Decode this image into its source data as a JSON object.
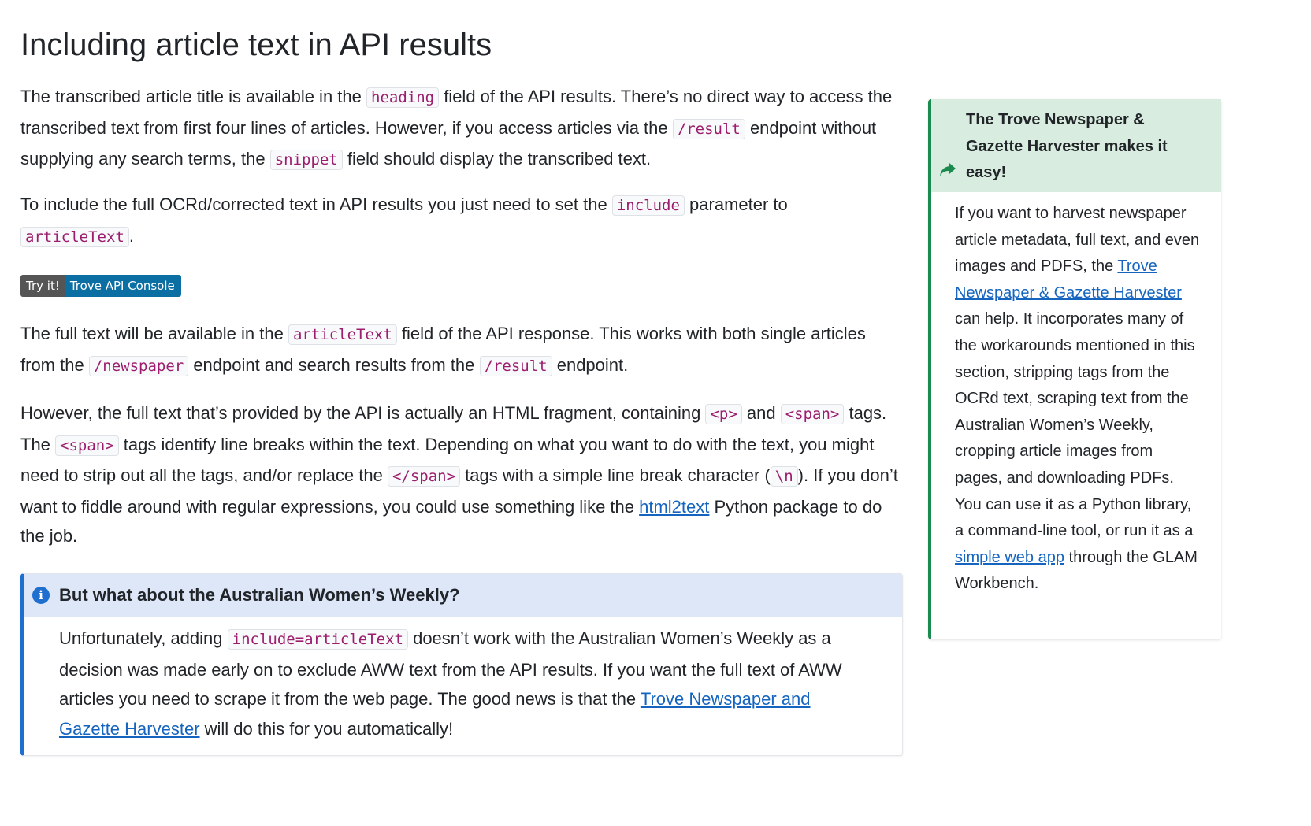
{
  "heading": "Including article text in API results",
  "para1": {
    "t1": "The transcribed article title is available in the ",
    "c1": "heading",
    "t2": " field of the API results. There’s no direct way to access the transcribed text from first four lines of articles. However, if you access articles via the ",
    "c2": "/result",
    "t3": " endpoint without supplying any search terms, the ",
    "c3": "snippet",
    "t4": " field should display the transcribed text."
  },
  "para2": {
    "t1": "To include the full OCRd/corrected text in API results you just need to set the ",
    "c1": "include",
    "t2": " parameter to ",
    "c2": "articleText",
    "t3": "."
  },
  "badge": {
    "left": "Try it!",
    "right": "Trove API Console"
  },
  "para3": {
    "t1": "The full text will be available in the ",
    "c1": "articleText",
    "t2": " field of the API response. This works with both single articles from the ",
    "c2": "/newspaper",
    "t3": " endpoint and search results from the ",
    "c3": "/result",
    "t4": " endpoint."
  },
  "para4": {
    "t1": "However, the full text that’s provided by the API is actually an HTML fragment, containing ",
    "c1": "<p>",
    "t2": " and ",
    "c2": "<span>",
    "t3": " tags. The ",
    "c3": "<span>",
    "t4": " tags identify line breaks within the text. Depending on what you want to do with the text, you might need to strip out all the tags, and/or replace the ",
    "c4": "</span>",
    "t5": " tags with a simple line break character (",
    "c5": "\\n",
    "t6": "). If you don’t want to fiddle around with regular expressions, you could use something like the ",
    "link": "html2text",
    "t7": " Python package to do the job."
  },
  "callout": {
    "icon": "i",
    "title": "But what about the Australian Women’s Weekly?",
    "t1": "Unfortunately, adding ",
    "c1": "include=articleText",
    "t2": " doesn’t work with the Australian Women’s Weekly as a decision was made early on to exclude AWW text from the API results. If you want the full text of AWW articles you need to scrape it from the web page. The good news is that the ",
    "link": "Trove Newspaper and Gazette Harvester",
    "t3": " will do this for you automatically!"
  },
  "aside": {
    "title": "The Trove Newspaper & Gazette Harvester makes it easy!",
    "t1": "If you want to harvest newspaper article metadata, full text, and even images and PDFS, the ",
    "link1": "Trove Newspaper & Gazette Harvester",
    "t2": " can help. It incorporates many of the workarounds mentioned in this section, stripping tags from the OCRd text, scraping text from the Australian Women’s Weekly, cropping article images from pages, and downloading PDFs. You can use it as a Python library, a command-line tool, or run it as a ",
    "link2": "simple web app",
    "t3": " through the GLAM Workbench."
  },
  "colors": {
    "text": "#212529",
    "code": "#9c1d6e",
    "link": "#1565c0",
    "info_accent": "#1f6fd1",
    "tip_accent": "#1b8a4f"
  }
}
